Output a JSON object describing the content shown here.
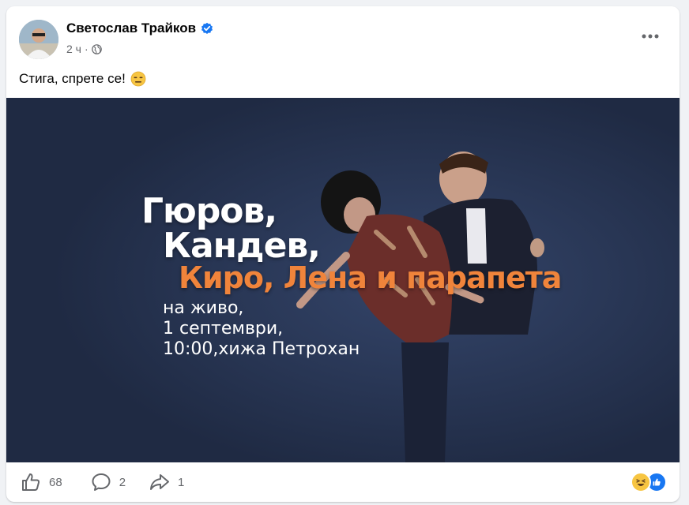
{
  "post": {
    "author": "Светослав Трайков",
    "time": "2 ч",
    "text": "Стига, спрете се!",
    "text_emoji": "expressionless-face"
  },
  "media": {
    "headline_line1": "Гюров,",
    "headline_line2": "Кандев,",
    "headline_line3": "Киро, Лена и парапета",
    "sub_line1": "на живо,",
    "sub_line2": "1 септември,",
    "sub_line3": "10:00,хижа Петрохан",
    "colors": {
      "background": "#23304a",
      "accent": "#f0843b"
    }
  },
  "footer": {
    "likes": "68",
    "comments": "2",
    "shares": "1"
  },
  "colors": {
    "verified": "#1877f2",
    "muted": "#65676b"
  }
}
